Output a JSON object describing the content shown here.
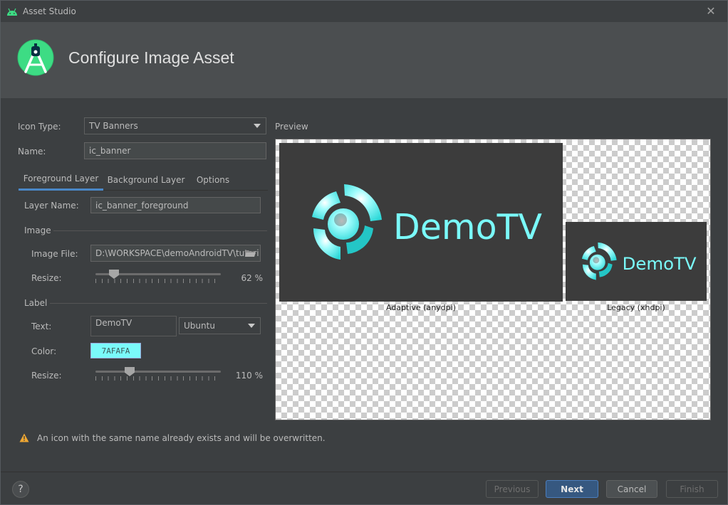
{
  "window": {
    "title": "Asset Studio"
  },
  "header": {
    "title": "Configure Image Asset"
  },
  "form": {
    "icon_type_label": "Icon Type:",
    "icon_type_value": "TV Banners",
    "name_label": "Name:",
    "name_value": "ic_banner"
  },
  "tabs": [
    {
      "label": "Foreground Layer",
      "active": true
    },
    {
      "label": "Background Layer",
      "active": false
    },
    {
      "label": "Options",
      "active": false
    }
  ],
  "layer": {
    "layer_name_label": "Layer Name:",
    "layer_name_value": "ic_banner_foreground",
    "image_section": "Image",
    "image_file_label": "Image File:",
    "image_file_value": "D:\\WORKSPACE\\demoAndroidTV\\tutori",
    "resize_label": "Resize:",
    "image_resize_value": "62 %",
    "image_resize_percent": 62,
    "label_section": "Label",
    "text_label": "Text:",
    "text_value": "DemoTV",
    "font_value": "Ubuntu",
    "color_label": "Color:",
    "color_value": "7AFAFA",
    "label_resize_value": "110 %",
    "label_resize_percent": 110
  },
  "preview": {
    "title": "Preview",
    "banner_text": "DemoTV",
    "adaptive_caption": "Adaptive (anydpi)",
    "legacy_caption": "Legacy (xhdpi)"
  },
  "warning": "An icon with the same name already exists and will be overwritten.",
  "buttons": {
    "help": "?",
    "previous": "Previous",
    "next": "Next",
    "cancel": "Cancel",
    "finish": "Finish"
  },
  "colors": {
    "accent": "#4a88c7",
    "label_color": "#7AFAFA",
    "android_green": "#3ddc84"
  }
}
